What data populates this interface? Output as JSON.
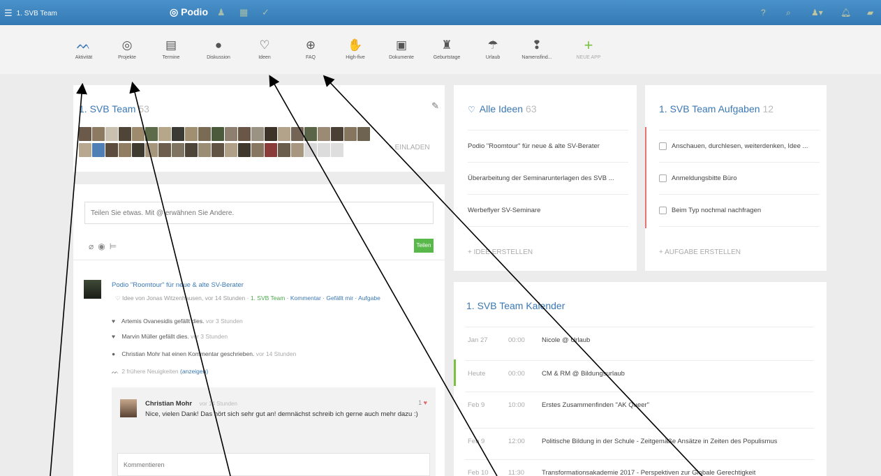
{
  "topbar": {
    "workspace": "1. SVB Team",
    "logo": "Podio",
    "colors": {
      "bar": "#3b84bf",
      "link": "#3a78b5",
      "accent_green": "#59b84a"
    }
  },
  "apps": [
    {
      "label": "Aktivität",
      "icon": "activity-icon"
    },
    {
      "label": "Projekte",
      "icon": "projects-icon"
    },
    {
      "label": "Termine",
      "icon": "calendar-icon"
    },
    {
      "label": "Diskussion",
      "icon": "discussion-icon"
    },
    {
      "label": "Ideen",
      "icon": "lightbulb-icon"
    },
    {
      "label": "FAQ",
      "icon": "faq-icon"
    },
    {
      "label": "High-five",
      "icon": "high-five-icon"
    },
    {
      "label": "Dokumente",
      "icon": "documents-icon"
    },
    {
      "label": "Geburtstage",
      "icon": "birthday-icon"
    },
    {
      "label": "Urlaub",
      "icon": "vacation-icon"
    },
    {
      "label": "Namensfind...",
      "icon": "pin-icon"
    },
    {
      "label": "NEUE APP",
      "icon": "plus-icon"
    }
  ],
  "team": {
    "title": "1. SVB Team",
    "count": "53",
    "invite": "+ EINLADEN"
  },
  "share": {
    "placeholder": "Teilen Sie etwas. Mit @ erwähnen Sie Andere.",
    "button": "Teilen"
  },
  "post": {
    "title": "Podio \"Roomtour\" für neue & alte SV-Berater",
    "meta_prefix": "Idee von Jonas Witzenhausen, vor 14 Stunden ·",
    "meta_team": "1. SVB Team",
    "meta_actions": "· Kommentar · Gefällt mir · Aufgabe",
    "activities": [
      {
        "text": "Artemis Ovanesidis gefällt dies.",
        "time": "vor 3 Stunden"
      },
      {
        "text": "Marvin Müller gefällt dies.",
        "time": "vor 3 Stunden"
      },
      {
        "text": "Christian Mohr hat einen Kommentar geschrieben.",
        "time": "vor 14 Stunden"
      }
    ],
    "earlier": "2 frühere Neuigkeiten",
    "earlier_link": "(anzeigen)",
    "comment": {
      "author": "Christian Mohr",
      "time": "vor 14 Stunden",
      "likes": "1",
      "text": "Nice, vielen Dank! Das hört sich sehr gut an! demnächst schreib ich gerne auch mehr dazu :)"
    },
    "comment_placeholder": "Kommentieren"
  },
  "ideas": {
    "title": "Alle Ideen",
    "count": "63",
    "items": [
      "Podio \"Roomtour\" für neue & alte SV-Berater",
      "Überarbeitung der Seminarunterlagen des SVB ...",
      "Werbeflyer SV-Seminare"
    ],
    "create": "+ IDEE ERSTELLEN"
  },
  "tasks": {
    "title": "1. SVB Team Aufgaben",
    "count": "12",
    "items": [
      "Anschauen, durchlesen, weiterdenken, Idee ...",
      "Anmeldungsbitte Büro",
      "Beim Typ nochmal nachfragen"
    ],
    "create": "+ AUFGABE ERSTELLEN"
  },
  "calendar": {
    "title": "1. SVB Team Kalender",
    "events": [
      {
        "date": "Jan 27",
        "time": "00:00",
        "name": "Nicole @ Urlaub"
      },
      {
        "date": "Heute",
        "time": "00:00",
        "name": "CM & RM @ Bildungsurlaub"
      },
      {
        "date": "Feb 9",
        "time": "10:00",
        "name": "Erstes Zusammenfinden \"AK Queer\""
      },
      {
        "date": "Feb 9",
        "time": "12:00",
        "name": "Politische Bildung in der Schule - Zeitgemäße Ansätze in Zeiten des Populismus"
      },
      {
        "date": "Feb 10",
        "time": "11:30",
        "name": "Transformationsakademie 2017 - Perspektiven zur Globale Gerechtigkeit"
      }
    ]
  }
}
